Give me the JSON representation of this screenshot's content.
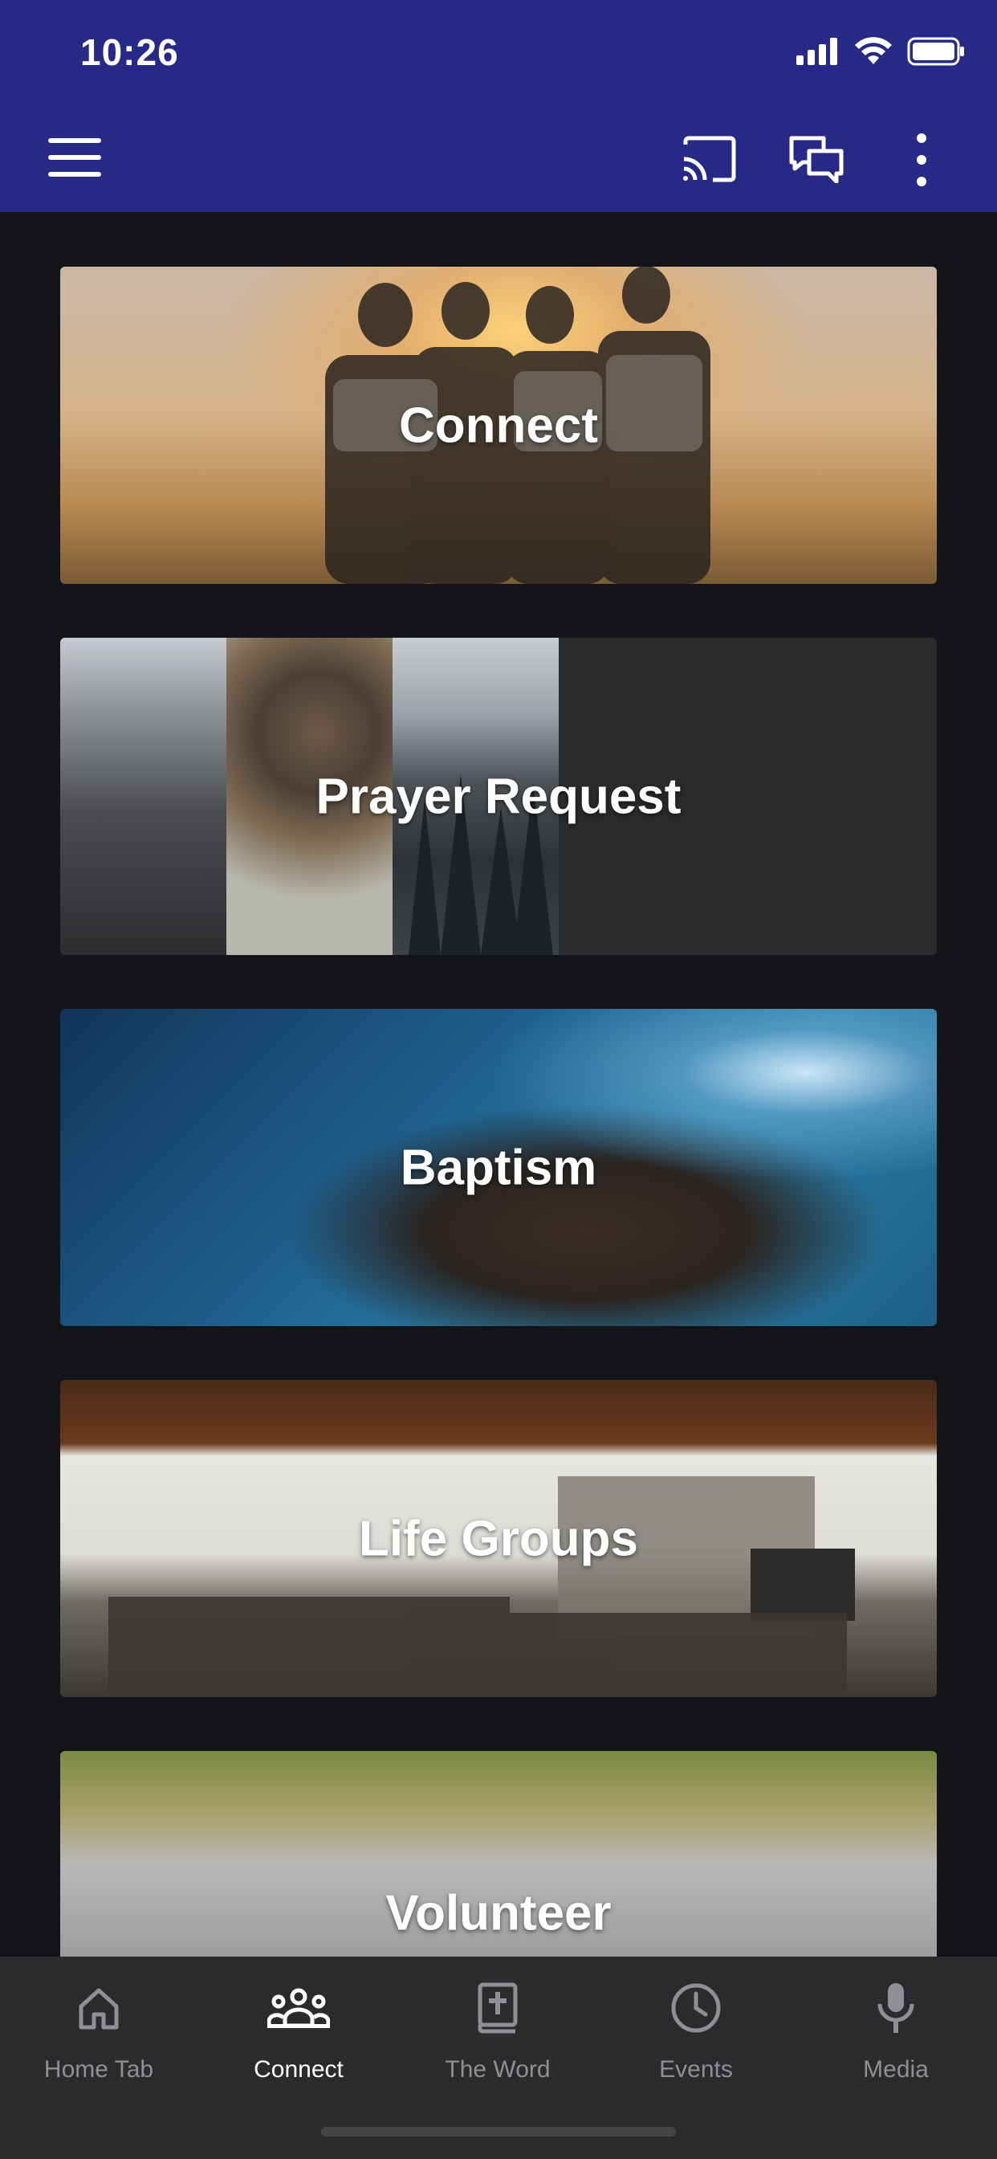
{
  "status_bar": {
    "time": "10:26"
  },
  "app_bar": {
    "menu_icon": "hamburger-menu-icon",
    "actions": [
      "cast-icon",
      "chat-icon",
      "more-vertical-icon"
    ]
  },
  "cards": [
    {
      "label": "Connect"
    },
    {
      "label": "Prayer Request"
    },
    {
      "label": "Baptism"
    },
    {
      "label": "Life Groups"
    },
    {
      "label": "Volunteer"
    }
  ],
  "bottom_nav": {
    "items": [
      {
        "label": "Home Tab",
        "icon": "home-icon"
      },
      {
        "label": "Connect",
        "icon": "people-icon",
        "active": true
      },
      {
        "label": "The Word",
        "icon": "bible-icon"
      },
      {
        "label": "Events",
        "icon": "clock-icon"
      },
      {
        "label": "Media",
        "icon": "microphone-icon"
      }
    ]
  },
  "colors": {
    "app_bar": "#262a86",
    "background": "#131417",
    "nav_background": "#2a2b2d",
    "nav_active": "#ffffff",
    "nav_inactive": "#8f9093"
  }
}
